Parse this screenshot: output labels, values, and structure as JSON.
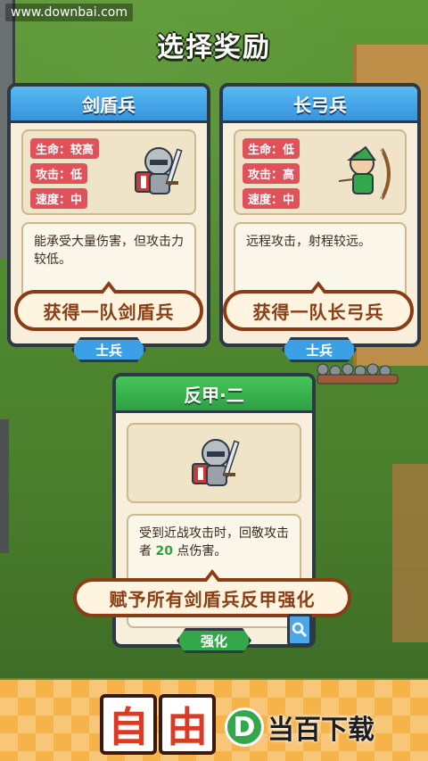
{
  "watermark": "www.downbai.com",
  "title": "选择奖励",
  "cards": [
    {
      "name": "剑盾兵",
      "stats": [
        "生命：较高",
        "攻击：低",
        "速度：中"
      ],
      "desc": "能承受大量伤害，但攻击力较低。",
      "banner": "获得一队剑盾兵",
      "tag": "士兵"
    },
    {
      "name": "长弓兵",
      "stats": [
        "生命：低",
        "攻击：高",
        "速度：中"
      ],
      "desc": "远程攻击，射程较远。",
      "banner": "获得一队长弓兵",
      "tag": "士兵"
    }
  ],
  "upgrade": {
    "name": "反甲·二",
    "desc_before": "受到近战攻击时，回敬攻击者 ",
    "desc_value": "20",
    "desc_after": " 点伤害。",
    "banner": "赋予所有剑盾兵反甲强化",
    "tag": "强化"
  },
  "bottom": {
    "chars": [
      "自",
      "由"
    ],
    "logo_letter": "D",
    "logo_text": "当百下载"
  },
  "icons": [
    "knight-icon",
    "archer-icon",
    "search-icon"
  ],
  "colors": {
    "accent_blue": "#3ca0e6",
    "accent_green": "#34a74a",
    "stat_red": "#e0515a",
    "banner_brown": "#8a3d14"
  }
}
